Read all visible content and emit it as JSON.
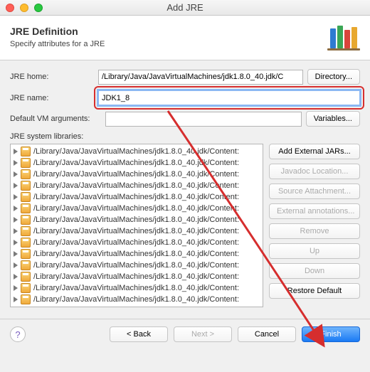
{
  "window": {
    "title": "Add JRE"
  },
  "header": {
    "title": "JRE Definition",
    "subtitle": "Specify attributes for a JRE"
  },
  "form": {
    "jre_home_label": "JRE home:",
    "jre_home_value": "/Library/Java/JavaVirtualMachines/jdk1.8.0_40.jdk/C",
    "directory_label": "Directory...",
    "jre_name_label": "JRE name:",
    "jre_name_value": "JDK1_8",
    "vm_args_label": "Default VM arguments:",
    "vm_args_value": "",
    "variables_label": "Variables..."
  },
  "list": {
    "label": "JRE system libraries:",
    "items": [
      "/Library/Java/JavaVirtualMachines/jdk1.8.0_40.jdk/Content:",
      "/Library/Java/JavaVirtualMachines/jdk1.8.0_40.jdk/Content:",
      "/Library/Java/JavaVirtualMachines/jdk1.8.0_40.jdk/Content:",
      "/Library/Java/JavaVirtualMachines/jdk1.8.0_40.jdk/Content:",
      "/Library/Java/JavaVirtualMachines/jdk1.8.0_40.jdk/Content:",
      "/Library/Java/JavaVirtualMachines/jdk1.8.0_40.jdk/Content:",
      "/Library/Java/JavaVirtualMachines/jdk1.8.0_40.jdk/Content:",
      "/Library/Java/JavaVirtualMachines/jdk1.8.0_40.jdk/Content:",
      "/Library/Java/JavaVirtualMachines/jdk1.8.0_40.jdk/Content:",
      "/Library/Java/JavaVirtualMachines/jdk1.8.0_40.jdk/Content:",
      "/Library/Java/JavaVirtualMachines/jdk1.8.0_40.jdk/Content:",
      "/Library/Java/JavaVirtualMachines/jdk1.8.0_40.jdk/Content:",
      "/Library/Java/JavaVirtualMachines/jdk1.8.0_40.jdk/Content:",
      "/Library/Java/JavaVirtualMachines/jdk1.8.0_40.jdk/Content:"
    ]
  },
  "sidebuttons": {
    "add_external": "Add External JARs...",
    "javadoc": "Javadoc Location...",
    "source": "Source Attachment...",
    "external_ann": "External annotations...",
    "remove": "Remove",
    "up": "Up",
    "down": "Down",
    "restore": "Restore Default"
  },
  "footer": {
    "back": "< Back",
    "next": "Next >",
    "cancel": "Cancel",
    "finish": "Finish"
  }
}
